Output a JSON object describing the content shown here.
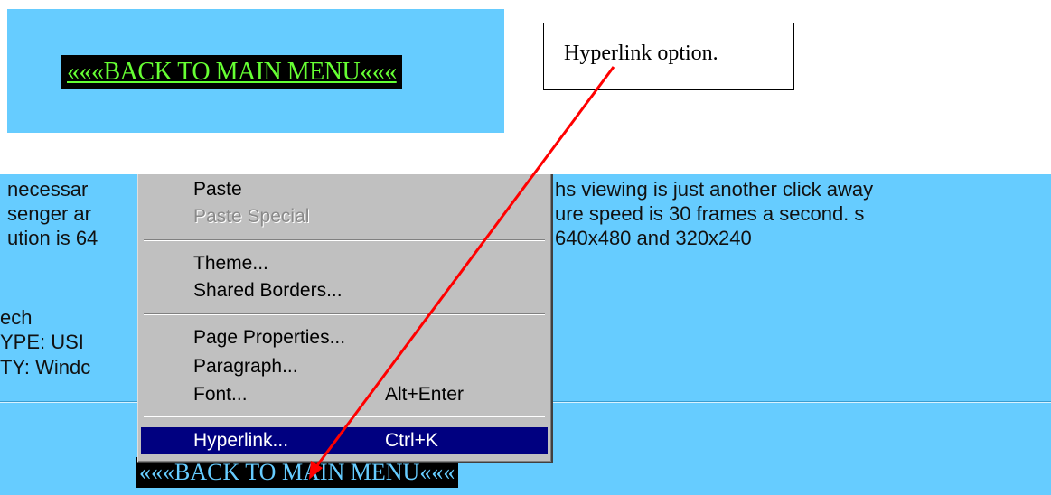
{
  "top_banner": {
    "link_text": "«««BACK TO MAIN MENU«««"
  },
  "callout": {
    "text": "Hyperlink option."
  },
  "page": {
    "lines": [
      "necessar",
      "senger ar",
      "ution is 64",
      "ech",
      "YPE: USI",
      "TY: Windc"
    ],
    "right_lines": [
      "hs viewing is just another click away",
      "ure speed is 30 frames a second. s",
      "640x480 and 320x240"
    ],
    "bottom_link_text": "«««BACK TO MAIN MENU«««"
  },
  "context_menu": {
    "paste": "Paste",
    "paste_special": "Paste Special",
    "theme": "Theme...",
    "shared_borders": "Shared Borders...",
    "page_properties": "Page Properties...",
    "paragraph": "Paragraph...",
    "font": "Font...",
    "font_shortcut": "Alt+Enter",
    "hyperlink": "Hyperlink...",
    "hyperlink_shortcut": "Ctrl+K"
  },
  "colors": {
    "page_background": "#66ccff",
    "menu_background": "#c0c0c0",
    "selection": "#000080",
    "arrow": "#ff0000",
    "top_link_text": "#66ff33"
  }
}
